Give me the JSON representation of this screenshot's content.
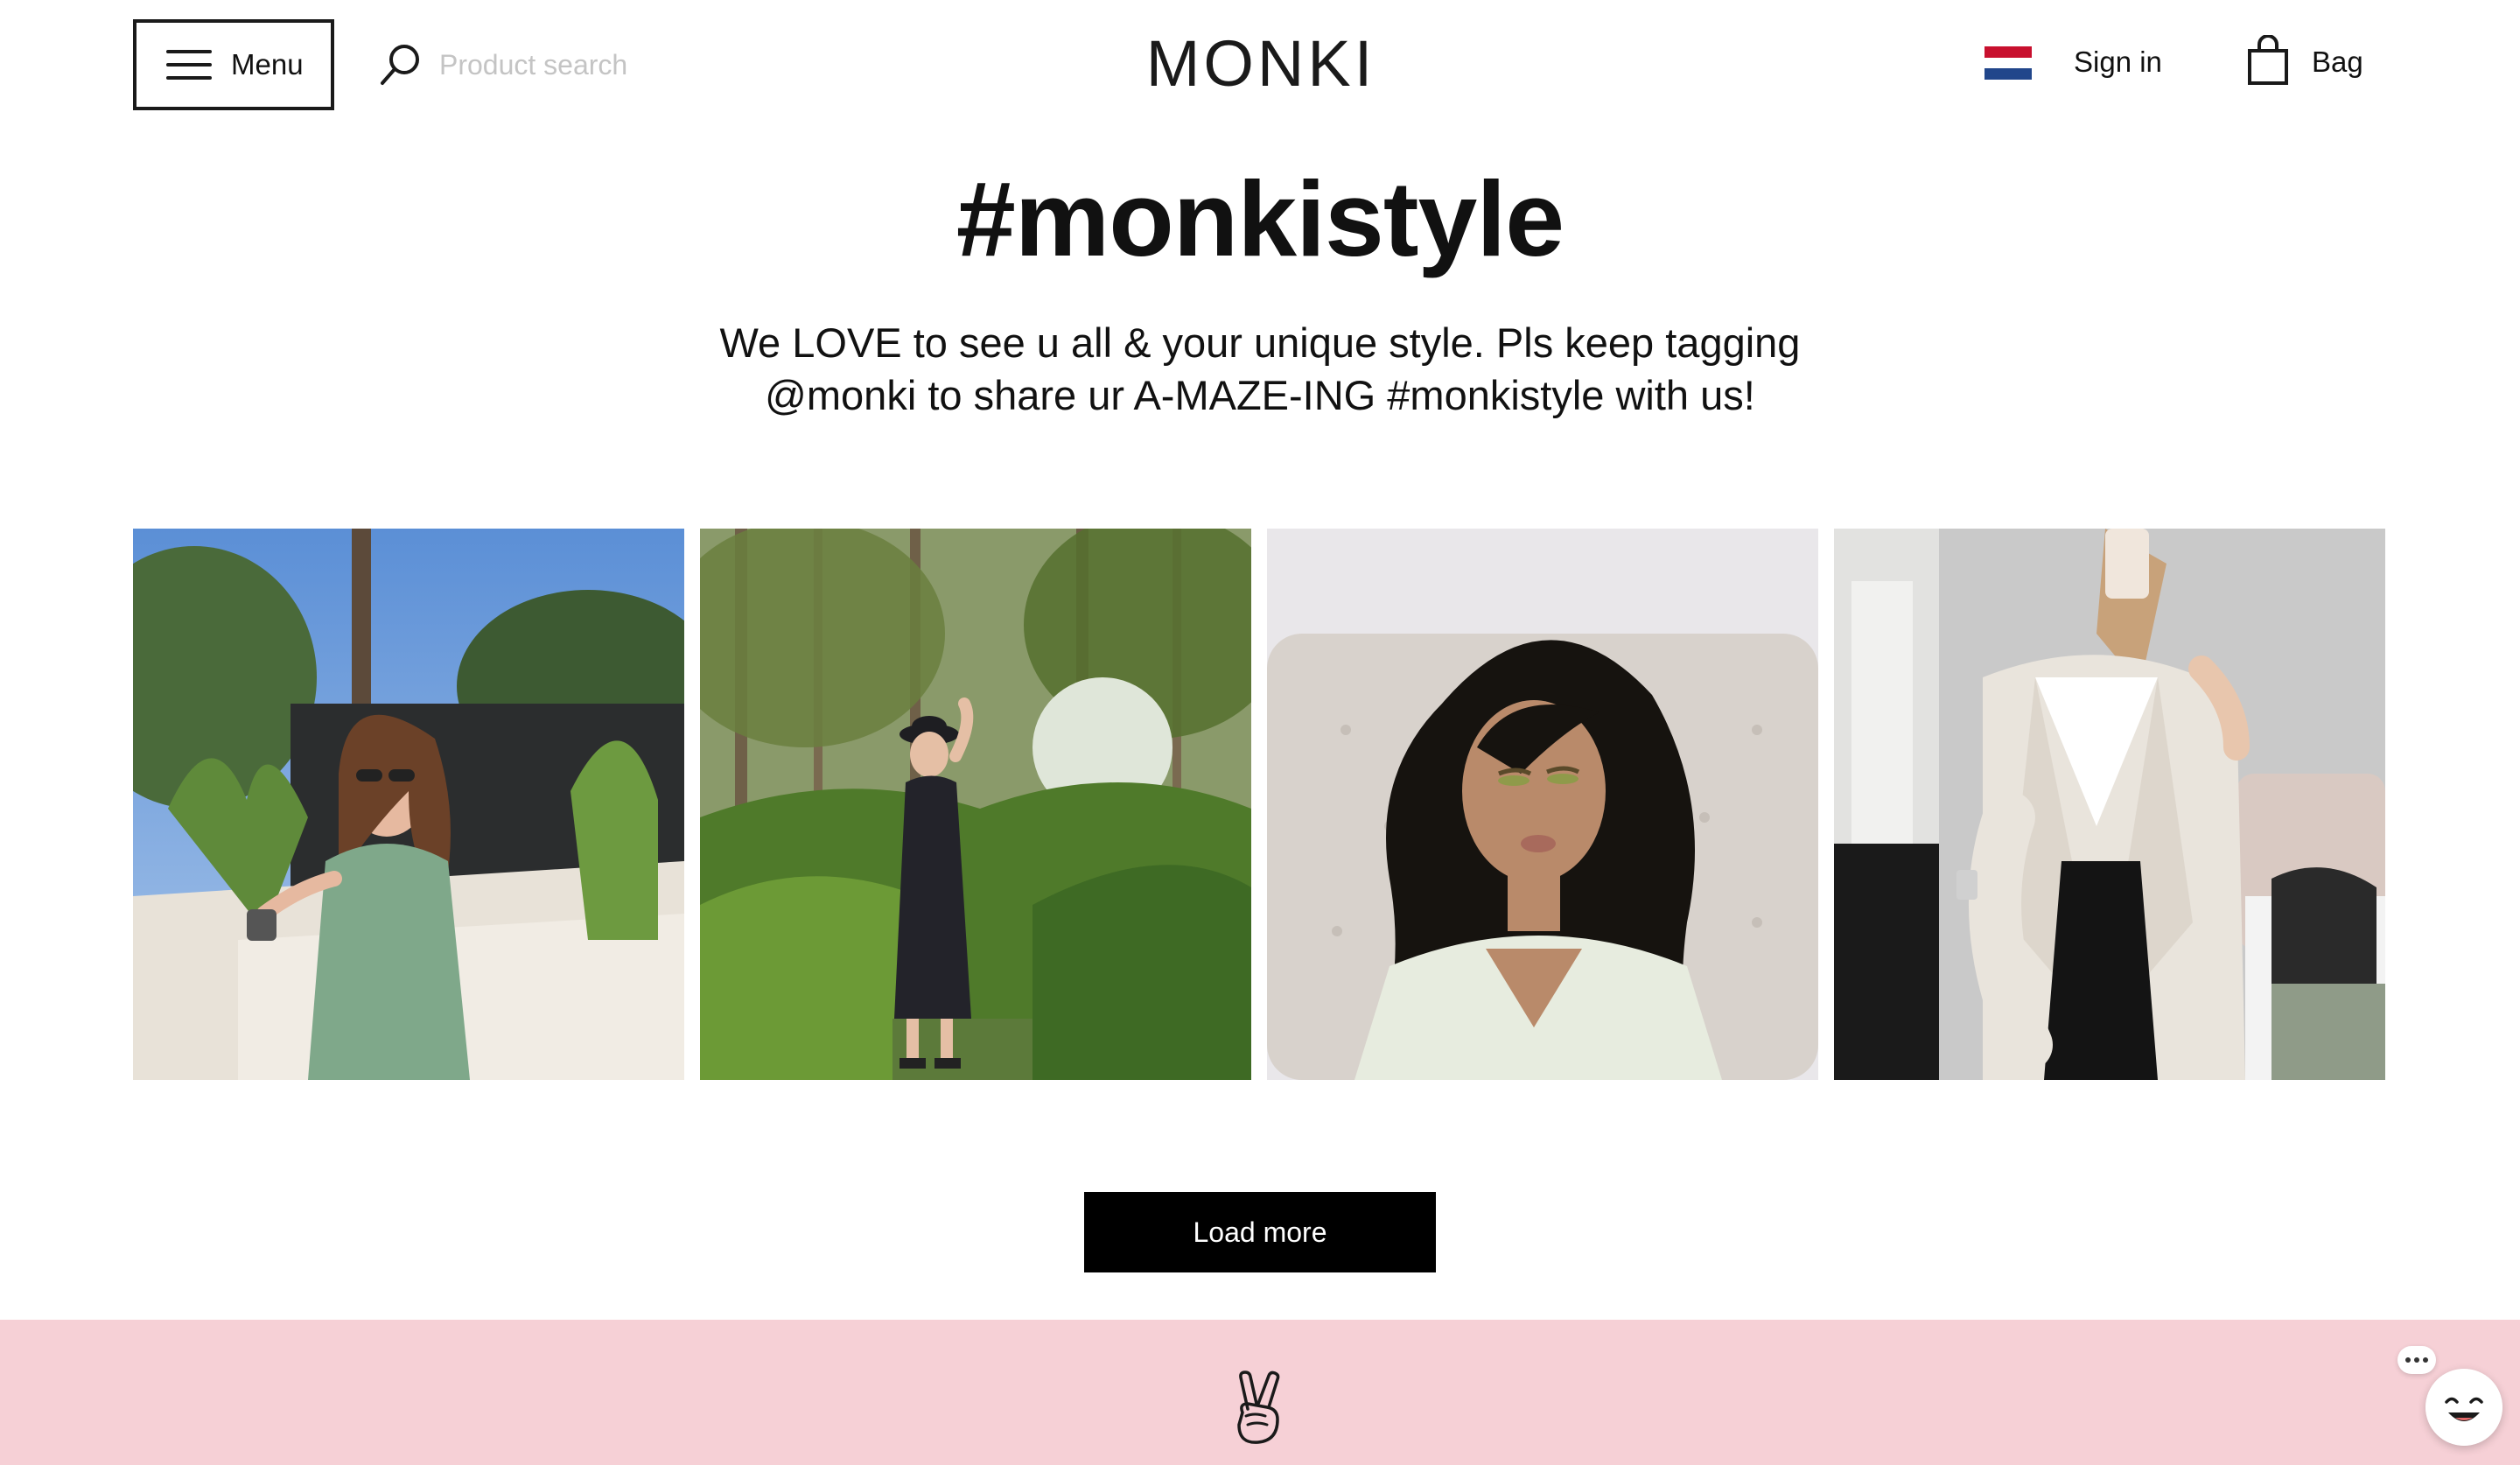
{
  "header": {
    "menu_label": "Menu",
    "search_placeholder": "Product search",
    "logo_text": "MONKI",
    "sign_in_label": "Sign in",
    "bag_label": "Bag"
  },
  "main": {
    "title": "#monkistyle",
    "tagline_line1": "We LOVE to see u all & your unique style. Pls keep tagging",
    "tagline_line2": "@monki to share ur A-MAZE-ING #monkistyle with us!",
    "load_more_label": "Load more"
  },
  "colors": {
    "footer_band": "#f6d0d6",
    "button_bg": "#000000",
    "flag_red": "#c8102e",
    "flag_white": "#ffffff",
    "flag_blue": "#21468b"
  },
  "icons": [
    "hamburger-icon",
    "search-icon",
    "flag-icon-netherlands",
    "bag-icon",
    "peace-hand-icon",
    "chat-icon"
  ]
}
